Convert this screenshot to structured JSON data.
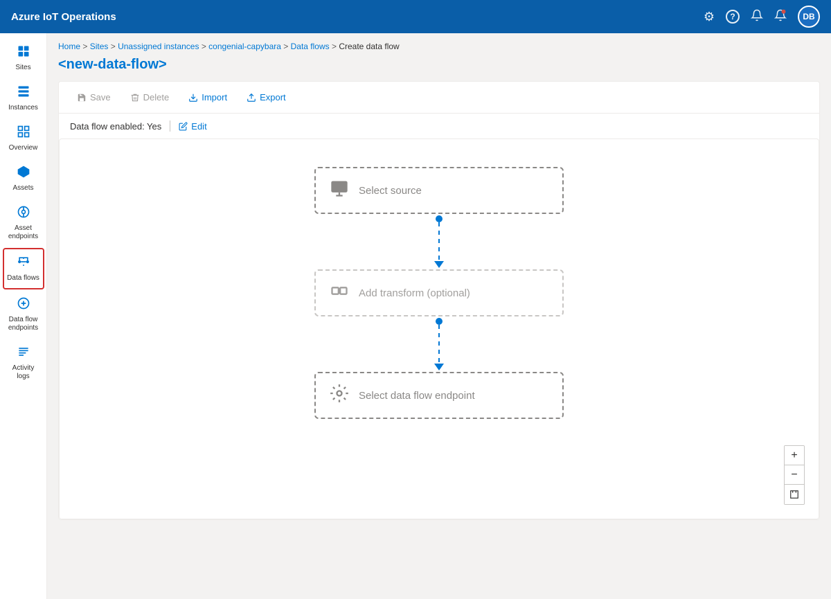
{
  "app": {
    "title": "Azure IoT Operations"
  },
  "topbar": {
    "title": "Azure IoT Operations",
    "avatar": "DB",
    "gear_label": "Settings",
    "help_label": "Help",
    "notification1_label": "Notifications",
    "notification2_label": "Alerts"
  },
  "sidebar": {
    "items": [
      {
        "id": "sites",
        "label": "Sites",
        "icon": "sites"
      },
      {
        "id": "instances",
        "label": "Instances",
        "icon": "instances"
      },
      {
        "id": "overview",
        "label": "Overview",
        "icon": "overview"
      },
      {
        "id": "assets",
        "label": "Assets",
        "icon": "assets"
      },
      {
        "id": "asset-endpoints",
        "label": "Asset endpoints",
        "icon": "asset-ep"
      },
      {
        "id": "data-flows",
        "label": "Data flows",
        "icon": "dataflows",
        "active": true
      },
      {
        "id": "df-endpoints",
        "label": "Data flow endpoints",
        "icon": "df-endpoints"
      },
      {
        "id": "activity-logs",
        "label": "Activity logs",
        "icon": "activity"
      }
    ]
  },
  "breadcrumb": {
    "parts": [
      "Home",
      "Sites",
      "Unassigned instances",
      "congenial-capybara",
      "Data flows",
      "Create data flow"
    ]
  },
  "page": {
    "title": "<new-data-flow>"
  },
  "toolbar": {
    "save_label": "Save",
    "delete_label": "Delete",
    "import_label": "Import",
    "export_label": "Export"
  },
  "flow_status": {
    "enabled_text": "Data flow enabled: Yes",
    "edit_label": "Edit"
  },
  "flow": {
    "source_label": "Select source",
    "transform_label": "Add transform (optional)",
    "destination_label": "Select data flow endpoint"
  },
  "zoom": {
    "plus_label": "+",
    "minus_label": "−",
    "fit_label": "⊡"
  }
}
